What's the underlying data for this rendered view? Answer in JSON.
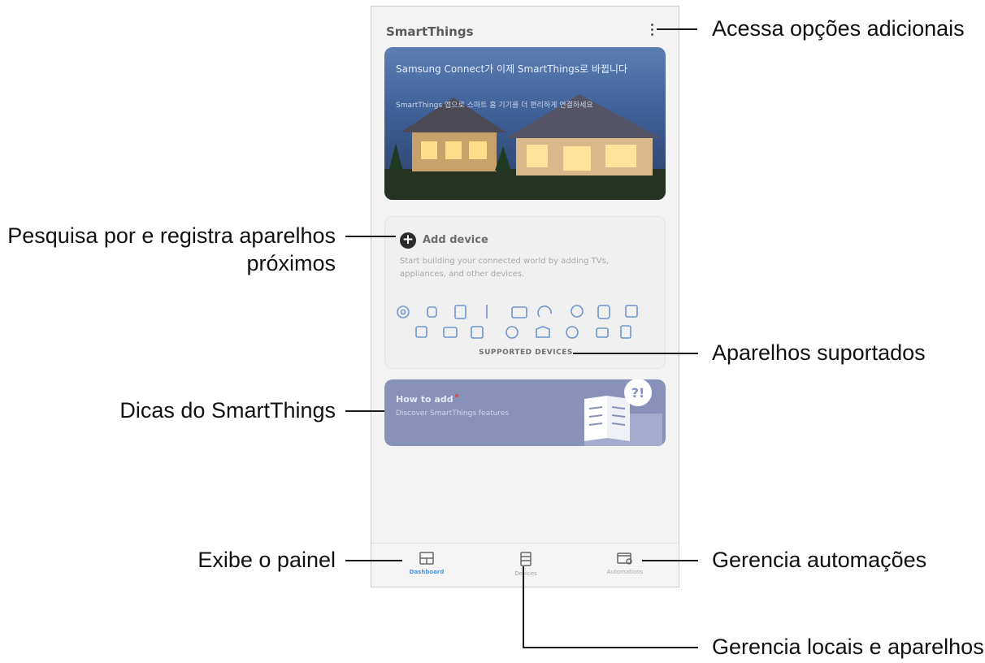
{
  "app": {
    "title": "SmartThings",
    "banner": {
      "title": "Samsung Connect가 이제 SmartThings로 바뀝니다",
      "subtitle": "SmartThings 앱으로 스마트 홈 기기를 더 편리하게 연결하세요"
    },
    "add_card": {
      "title": "Add device",
      "description": "Start building your connected world by adding TVs, appliances, and other devices.",
      "supported_button": "SUPPORTED DEVICES",
      "device_icons": [
        "speaker-icon",
        "bulb-icon",
        "washer-icon",
        "sensor-icon",
        "tv-icon",
        "plug-icon",
        "camera-icon",
        "robot-icon",
        "fridge-icon",
        "hub-icon",
        "oven-icon",
        "aircon-icon",
        "purifier-icon",
        "lock-icon",
        "vacuum-icon",
        "outlet-icon",
        "thermostat-icon"
      ]
    },
    "tips_card": {
      "title": "How to add",
      "subtitle": "Discover SmartThings features"
    },
    "tabs": [
      {
        "label": "Dashboard",
        "icon": "dashboard-icon",
        "active": true
      },
      {
        "label": "Devices",
        "icon": "devices-icon",
        "active": false
      },
      {
        "label": "Automations",
        "icon": "automations-icon",
        "active": false
      }
    ]
  },
  "callouts": {
    "more_options": "Acessa opções adicionais",
    "add_device_line1": "Pesquisa por e registra aparelhos",
    "add_device_line2": "próximos",
    "supported_devices": "Aparelhos suportados",
    "tips": "Dicas do SmartThings",
    "dashboard": "Exibe o painel",
    "automations": "Gerencia automações",
    "devices": "Gerencia locais e aparelhos"
  },
  "colors": {
    "accent": "#4e94e6",
    "banner": "#3e5f96",
    "tips_card": "#8891b8",
    "device_icon": "#6d97cf"
  }
}
